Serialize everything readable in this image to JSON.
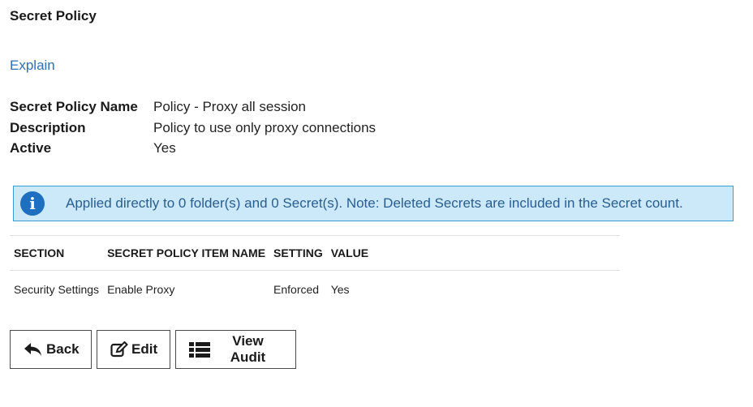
{
  "header": {
    "title": "Secret Policy"
  },
  "explain_link": "Explain",
  "details": [
    {
      "label": "Secret Policy Name",
      "value": "Policy - Proxy all session"
    },
    {
      "label": "Description",
      "value": "Policy to use only proxy connections"
    },
    {
      "label": "Active",
      "value": "Yes"
    }
  ],
  "alert": {
    "icon": "info-icon",
    "text": "Applied directly to 0 folder(s) and 0 Secret(s). Note: Deleted Secrets are included in the Secret count.",
    "background": "#cbe9f8",
    "border": "#3d9bd6"
  },
  "table": {
    "headers": [
      "SECTION",
      "SECRET POLICY ITEM NAME",
      "SETTING",
      "VALUE"
    ],
    "rows": [
      [
        "Security Settings",
        "Enable Proxy",
        "Enforced",
        "Yes"
      ]
    ]
  },
  "buttons": {
    "back": {
      "label": "Back",
      "icon": "reply-arrow-icon"
    },
    "edit": {
      "label": "Edit",
      "icon": "edit-icon"
    },
    "view_audit": {
      "label": "View Audit",
      "icon": "list-icon"
    }
  },
  "colors": {
    "link": "#2f6fb7",
    "info_icon": "#1e6fc0"
  }
}
